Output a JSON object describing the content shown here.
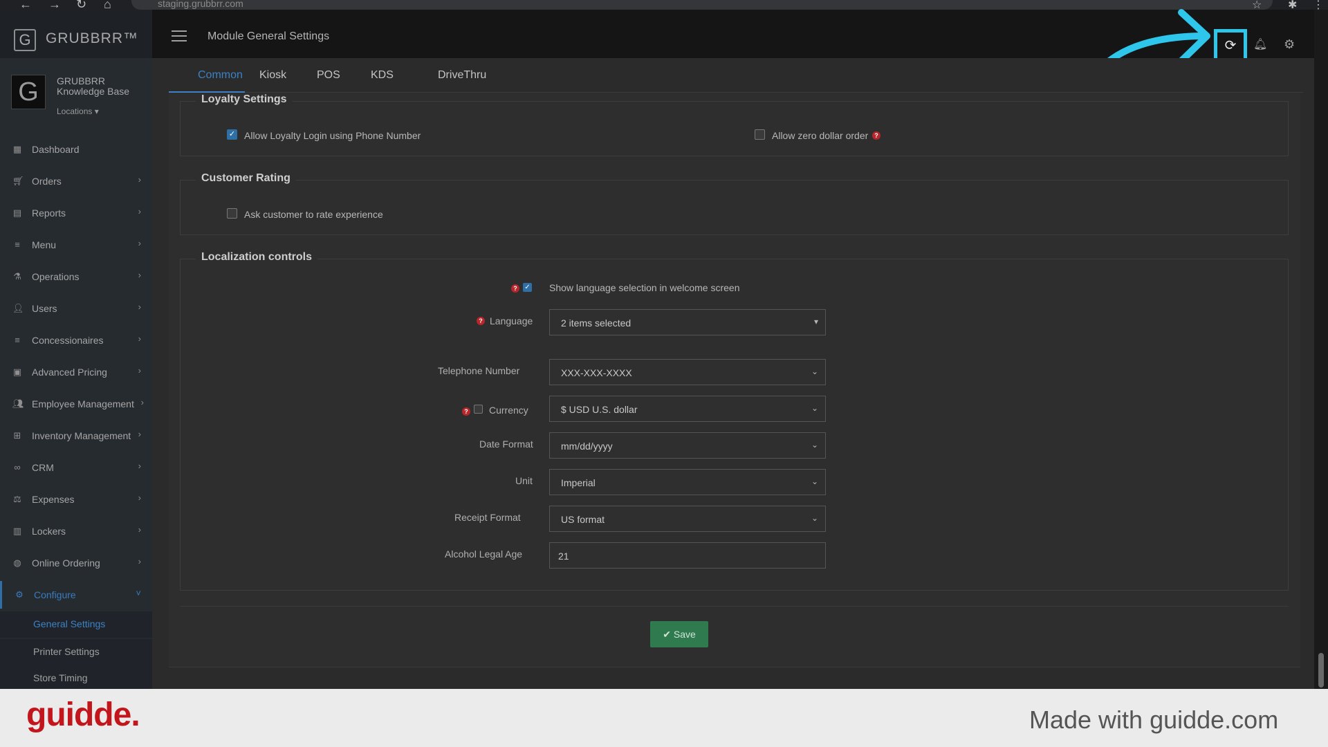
{
  "browser": {
    "url": "staging.grubbrr.com"
  },
  "header": {
    "brand": "GRUBBRR™",
    "title": "Module General Settings"
  },
  "profile": {
    "name": "GRUBBRR Knowledge Base",
    "locations_label": "Locations"
  },
  "sidebar": {
    "items": [
      {
        "label": "Dashboard",
        "icon": "dashboard-icon"
      },
      {
        "label": "Orders",
        "icon": "cart-icon"
      },
      {
        "label": "Reports",
        "icon": "report-icon"
      },
      {
        "label": "Menu",
        "icon": "list-icon"
      },
      {
        "label": "Operations",
        "icon": "flask-icon"
      },
      {
        "label": "Users",
        "icon": "user-plus-icon"
      },
      {
        "label": "Concessionaires",
        "icon": "list-icon"
      },
      {
        "label": "Advanced Pricing",
        "icon": "money-icon"
      },
      {
        "label": "Employee Management",
        "icon": "users-icon"
      },
      {
        "label": "Inventory Management",
        "icon": "sitemap-icon"
      },
      {
        "label": "CRM",
        "icon": "link-icon"
      },
      {
        "label": "Expenses",
        "icon": "scale-icon"
      },
      {
        "label": "Lockers",
        "icon": "locker-icon"
      },
      {
        "label": "Online Ordering",
        "icon": "globe-icon"
      },
      {
        "label": "Configure",
        "icon": "gear-icon"
      }
    ],
    "sub_items": [
      {
        "label": "General Settings"
      },
      {
        "label": "Printer Settings"
      },
      {
        "label": "Store Timing"
      }
    ]
  },
  "tabs": [
    {
      "label": "Common"
    },
    {
      "label": "Kiosk"
    },
    {
      "label": "POS"
    },
    {
      "label": "KDS"
    },
    {
      "label": "DriveThru"
    }
  ],
  "loyalty": {
    "title": "Loyalty Settings",
    "phone_login": {
      "label": "Allow Loyalty Login using Phone Number",
      "checked": true
    },
    "zero_dollar": {
      "label": "Allow zero dollar order",
      "checked": false
    }
  },
  "rating": {
    "title": "Customer Rating",
    "ask": {
      "label": "Ask customer to rate experience",
      "checked": false
    }
  },
  "localization": {
    "title": "Localization controls",
    "show_language": {
      "label": "Show language selection in welcome screen",
      "checked": true
    },
    "language": {
      "label": "Language",
      "value": "2 items selected"
    },
    "telephone": {
      "label": "Telephone Number",
      "value": "XXX-XXX-XXXX"
    },
    "currency": {
      "label": "Currency",
      "value": "$ USD U.S. dollar",
      "checked": false
    },
    "date_format": {
      "label": "Date Format",
      "value": "mm/dd/yyyy"
    },
    "unit": {
      "label": "Unit",
      "value": "Imperial"
    },
    "receipt_format": {
      "label": "Receipt Format",
      "value": "US format"
    },
    "alcohol_age": {
      "label": "Alcohol Legal Age",
      "value": "21"
    }
  },
  "actions": {
    "save_label": "✔ Save"
  },
  "footer": {
    "logo": "guidde.",
    "text": "Made with guidde.com"
  },
  "colors": {
    "highlight": "#2ec6ea",
    "accent": "#3b82c6",
    "save": "#2f7a4e",
    "help": "#b8262b"
  }
}
